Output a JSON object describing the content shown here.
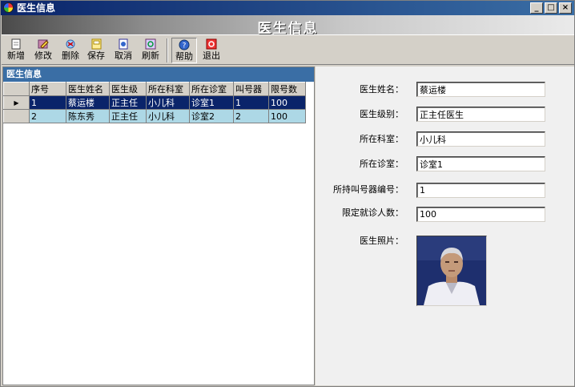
{
  "window": {
    "title": "医生信息"
  },
  "banner": {
    "title": "医生信息"
  },
  "toolbar": {
    "buttons": [
      {
        "label": "新增",
        "icon": "new-document-icon"
      },
      {
        "label": "修改",
        "icon": "edit-icon"
      },
      {
        "label": "删除",
        "icon": "delete-icon"
      },
      {
        "label": "保存",
        "icon": "save-icon"
      },
      {
        "label": "取消",
        "icon": "cancel-icon"
      },
      {
        "label": "刷新",
        "icon": "refresh-icon"
      },
      {
        "label": "帮助",
        "icon": "help-icon"
      },
      {
        "label": "退出",
        "icon": "exit-icon"
      }
    ]
  },
  "list": {
    "header": "医生信息",
    "columns": [
      "序号",
      "医生姓名",
      "医生级",
      "所在科室",
      "所在诊室",
      "叫号器",
      "限号数"
    ],
    "rows": [
      [
        "1",
        "蔡运楼",
        "正主任",
        "小儿科",
        "诊室1",
        "1",
        "100"
      ],
      [
        "2",
        "陈东秀",
        "正主任",
        "小儿科",
        "诊室2",
        "2",
        "100"
      ]
    ],
    "selected_row": 0
  },
  "form": {
    "name_label": "医生姓名：",
    "name_value": "蔡运楼",
    "level_label": "医生级别：",
    "level_value": "正主任医生",
    "dept_label": "所在科室：",
    "dept_value": "小儿科",
    "room_label": "所在诊室：",
    "room_value": "诊室1",
    "caller_label": "所持叫号器编号：",
    "caller_value": "1",
    "limit_label": "限定就诊人数：",
    "limit_value": "100",
    "photo_label": "医生照片："
  },
  "colors": {
    "titlebar": "#0a246a",
    "selected_row": "#0a246a",
    "normal_row": "#add8e6",
    "pane_header": "#3a6ea5"
  }
}
